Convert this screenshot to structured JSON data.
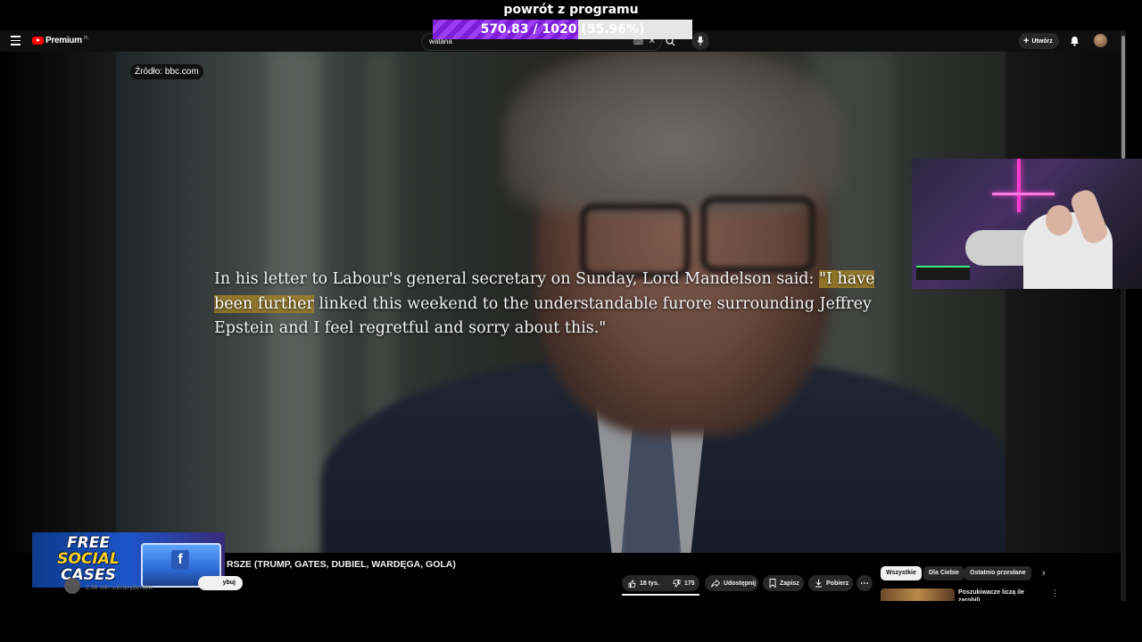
{
  "overlay": {
    "title": "powrót z programu",
    "progress_text": "570.83 / 1020",
    "progress_percent_text": "(55.96%)",
    "progress_fraction": 0.5596
  },
  "header": {
    "logo_text": "Premium",
    "logo_country": "PL",
    "search_value": "watana",
    "create_label": "Utwórz"
  },
  "video": {
    "source": "Źródło: bbc.com",
    "quote_before": "In his letter to Labour's general secretary on Sunday, Lord Mandelson said: ",
    "quote_highlight": "\"I have been further",
    "quote_after": " linked this weekend to the understandable furore surrounding Jeffrey Epstein and I feel regretful and sorry about this.\""
  },
  "banner": {
    "line1": "FREE",
    "line2": "SOCIAL",
    "line3": "CASES",
    "fb_letter": "f"
  },
  "below": {
    "video_title": "RSZE (TRUMP, GATES, DUBIEL, WARDĘGA, GOLA)",
    "subscribers": "2,98 mln subskrybentów",
    "subscribe_label": "ybuj",
    "likes": "18 tys.",
    "dislikes": "175",
    "share": "Udostępnij",
    "save": "Zapisz",
    "download": "Pobierz"
  },
  "chips": [
    "Wszystkie",
    "Dla Ciebie",
    "Ostatnio przesłane"
  ],
  "recommendation": {
    "title": "Poszukiwacze liczą ile zarobili"
  },
  "colors": {
    "progress_fill": "#8a2be2",
    "highlight": "#a08028",
    "youtube_red": "#ff0000"
  }
}
